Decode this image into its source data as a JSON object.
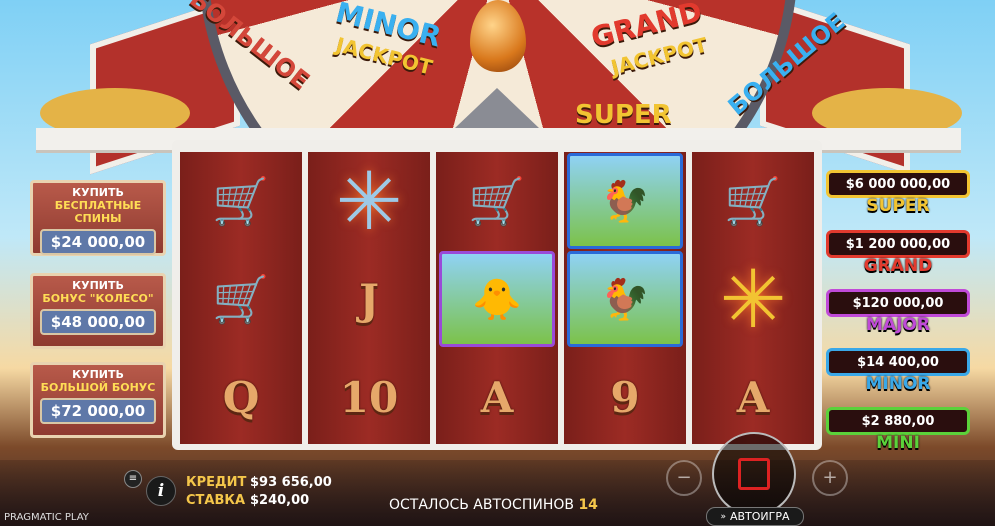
{
  "wheel": {
    "segments": [
      "БОЛЬШОЕ",
      "MINOR",
      "JACKPOT",
      "GRAND",
      "JACKPOT",
      "БОЛЬШОЕ",
      "БОЛЬШОЕ",
      "SUPER"
    ]
  },
  "buy_panels": [
    {
      "line1": "КУПИТЬ",
      "line2": "БЕСПЛАТНЫЕ СПИНЫ",
      "price": "$24 000,00"
    },
    {
      "line1": "КУПИТЬ",
      "line2": "БОНУС \"КОЛЕСО\"",
      "price": "$48 000,00"
    },
    {
      "line1": "КУПИТЬ",
      "line2": "БОЛЬШОЙ БОНУС",
      "price": "$72 000,00"
    }
  ],
  "reels": [
    [
      {
        "type": "icon",
        "name": "wheelbarrow-icon",
        "glyph": "🛒"
      },
      {
        "type": "icon",
        "name": "wheelbarrow-icon",
        "glyph": "🛒"
      },
      {
        "type": "letter",
        "text": "Q"
      }
    ],
    [
      {
        "type": "icon",
        "name": "windmill-blue-icon",
        "glyph": "✳"
      },
      {
        "type": "letter",
        "text": "J"
      },
      {
        "type": "letter",
        "text": "10"
      }
    ],
    [
      {
        "type": "icon",
        "name": "wheelbarrow-icon",
        "glyph": "🛒"
      },
      {
        "type": "icon",
        "name": "chick-icon",
        "glyph": "🐥"
      },
      {
        "type": "letter",
        "text": "A"
      }
    ],
    [
      {
        "type": "icon",
        "name": "rooster-icon",
        "glyph": "🐓"
      },
      {
        "type": "icon",
        "name": "rooster-icon",
        "glyph": "🐓"
      },
      {
        "type": "letter",
        "text": "9"
      }
    ],
    [
      {
        "type": "icon",
        "name": "wheelbarrow-icon",
        "glyph": "🛒"
      },
      {
        "type": "icon",
        "name": "windmill-gold-icon",
        "glyph": "✳"
      },
      {
        "type": "letter",
        "text": "A"
      }
    ]
  ],
  "jackpots": [
    {
      "value": "$6 000 000,00",
      "name": "SUPER",
      "color": "#f2c432"
    },
    {
      "value": "$1 200 000,00",
      "name": "GRAND",
      "color": "#e23a2e"
    },
    {
      "value": "$120 000,00",
      "name": "MAJOR",
      "color": "#c04ad8"
    },
    {
      "value": "$14 400,00",
      "name": "MINOR",
      "color": "#3aa8e8"
    },
    {
      "value": "$2 880,00",
      "name": "MINI",
      "color": "#5bd23a"
    }
  ],
  "bottom": {
    "credit_label": "КРЕДИТ",
    "credit_value": "$93 656,00",
    "bet_label": "СТАВКА",
    "bet_value": "$240,00",
    "autospins_label": "ОСТАЛОСЬ АВТОСПИНОВ",
    "autospins_count": "14",
    "autoplay_label": "АВТОИГРА",
    "brand": "PRAGMATIC PLAY"
  }
}
